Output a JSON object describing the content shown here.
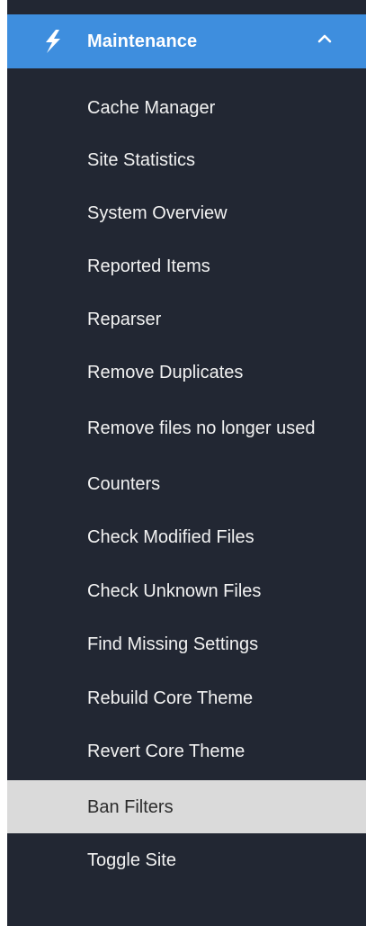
{
  "menu": {
    "section_title": "Maintenance",
    "section_icon": "lightning-bolt-icon",
    "toggle_icon": "chevron-up-icon",
    "colors": {
      "header_bg": "#3e8ede",
      "sidebar_bg": "#222733",
      "active_bg": "#dadada",
      "text": "#f2f2f2"
    },
    "items": [
      {
        "label": "Cache Manager"
      },
      {
        "label": "Site Statistics"
      },
      {
        "label": "System Overview"
      },
      {
        "label": "Reported Items"
      },
      {
        "label": "Reparser"
      },
      {
        "label": "Remove Duplicates"
      },
      {
        "label": "Remove files no longer used"
      },
      {
        "label": "Counters"
      },
      {
        "label": "Check Modified Files"
      },
      {
        "label": "Check Unknown Files"
      },
      {
        "label": "Find Missing Settings"
      },
      {
        "label": "Rebuild Core Theme"
      },
      {
        "label": "Revert Core Theme"
      },
      {
        "label": "Ban Filters",
        "active": true
      },
      {
        "label": "Toggle Site"
      }
    ]
  }
}
